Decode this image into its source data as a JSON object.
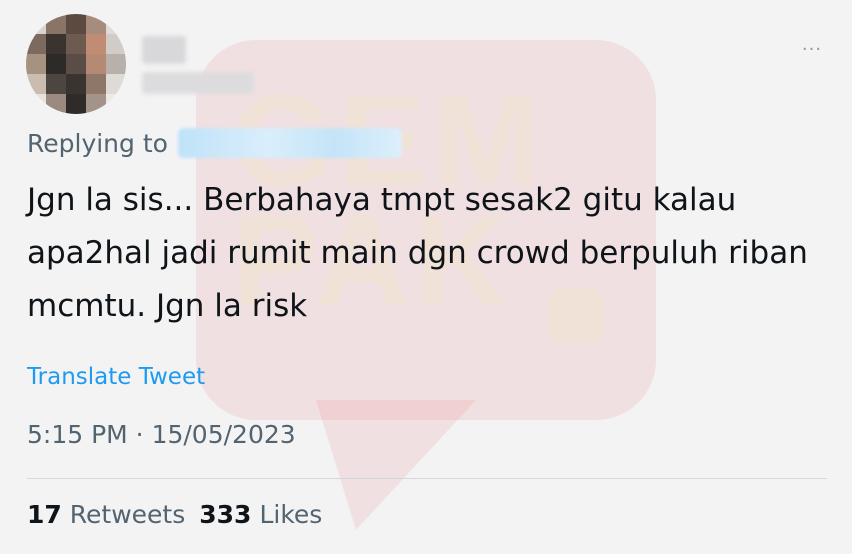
{
  "tweet": {
    "more_icon": "more-horizontal-icon",
    "more_label": "···",
    "replying_prefix": "Replying to",
    "text": "Jgn la sis... Berbahaya tmpt sesak2 gitu kalau apa2hal jadi rumit main dgn crowd berpuluh riban mcmtu. Jgn la risk",
    "translate_label": "Translate Tweet",
    "timestamp": "5:15 PM · 15/05/2023",
    "retweets": {
      "count": "17",
      "label": "Retweets"
    },
    "likes": {
      "count": "333",
      "label": "Likes"
    }
  },
  "watermark": {
    "text": "GEM PAK"
  },
  "colors": {
    "background": "#f3f3f4",
    "link": "#1d9bf0",
    "text_primary": "#0f1419",
    "text_secondary": "#536471",
    "watermark_red": "#ec6e6e"
  }
}
